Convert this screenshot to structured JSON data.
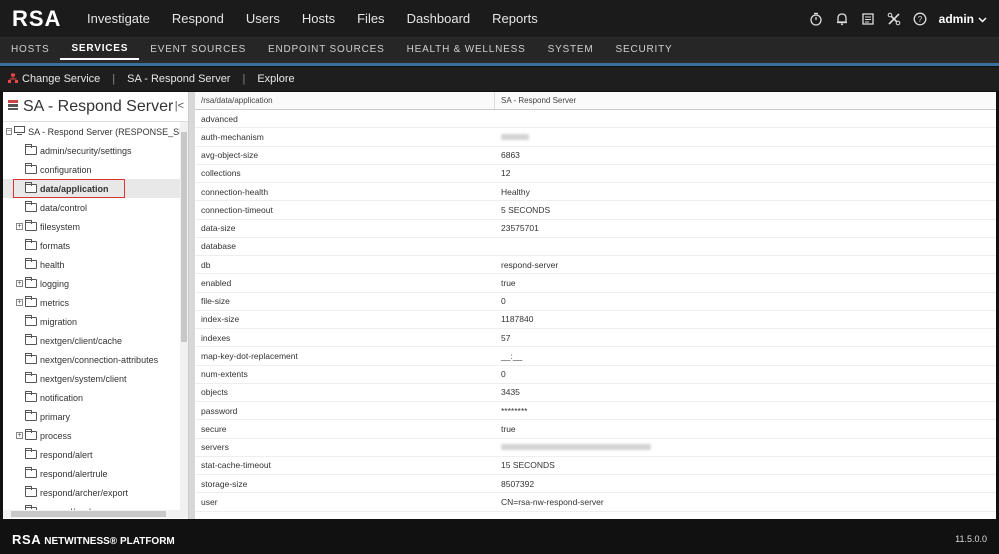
{
  "app": {
    "logo": "RSA"
  },
  "mainnav": [
    "Investigate",
    "Respond",
    "Users",
    "Hosts",
    "Files",
    "Dashboard",
    "Reports"
  ],
  "user": {
    "name": "admin"
  },
  "subnav": [
    "HOSTS",
    "SERVICES",
    "EVENT SOURCES",
    "ENDPOINT SOURCES",
    "HEALTH & WELLNESS",
    "SYSTEM",
    "SECURITY"
  ],
  "toolbar": {
    "change_service": "Change Service",
    "server": "SA - Respond Server",
    "explore": "Explore"
  },
  "left": {
    "title": "SA - Respond Server",
    "root": "SA - Respond Server (RESPONSE_SERV...",
    "items": [
      {
        "label": "admin/security/settings",
        "expand": false
      },
      {
        "label": "configuration",
        "expand": false
      },
      {
        "label": "data/application",
        "expand": false
      },
      {
        "label": "data/control",
        "expand": false
      },
      {
        "label": "filesystem",
        "expand": true
      },
      {
        "label": "formats",
        "expand": false
      },
      {
        "label": "health",
        "expand": false
      },
      {
        "label": "logging",
        "expand": true
      },
      {
        "label": "metrics",
        "expand": true
      },
      {
        "label": "migration",
        "expand": false
      },
      {
        "label": "nextgen/client/cache",
        "expand": false
      },
      {
        "label": "nextgen/connection-attributes",
        "expand": false
      },
      {
        "label": "nextgen/system/client",
        "expand": false
      },
      {
        "label": "notification",
        "expand": false
      },
      {
        "label": "primary",
        "expand": false
      },
      {
        "label": "process",
        "expand": true
      },
      {
        "label": "respond/alert",
        "expand": false
      },
      {
        "label": "respond/alertrule",
        "expand": false
      },
      {
        "label": "respond/archer/export",
        "expand": false
      },
      {
        "label": "respond/cache",
        "expand": false
      }
    ]
  },
  "table": {
    "header_path": "/rsa/data/application",
    "header_server": "SA - Respond Server",
    "rows": [
      {
        "k": "advanced",
        "v": ""
      },
      {
        "k": "auth-mechanism",
        "v": "",
        "blur": true
      },
      {
        "k": "avg-object-size",
        "v": "6863"
      },
      {
        "k": "collections",
        "v": "12"
      },
      {
        "k": "connection-health",
        "v": "Healthy"
      },
      {
        "k": "connection-timeout",
        "v": "5 SECONDS"
      },
      {
        "k": "data-size",
        "v": "23575701"
      },
      {
        "k": "database",
        "v": ""
      },
      {
        "k": "db",
        "v": "respond-server"
      },
      {
        "k": "enabled",
        "v": "true"
      },
      {
        "k": "file-size",
        "v": "0"
      },
      {
        "k": "index-size",
        "v": "1187840"
      },
      {
        "k": "indexes",
        "v": "57"
      },
      {
        "k": "map-key-dot-replacement",
        "v": "__:__"
      },
      {
        "k": "num-extents",
        "v": "0"
      },
      {
        "k": "objects",
        "v": "3435"
      },
      {
        "k": "password",
        "v": "********"
      },
      {
        "k": "secure",
        "v": "true"
      },
      {
        "k": "servers",
        "v": "",
        "blur": true
      },
      {
        "k": "stat-cache-timeout",
        "v": "15 SECONDS"
      },
      {
        "k": "storage-size",
        "v": "8507392"
      },
      {
        "k": "user",
        "v": "CN=rsa-nw-respond-server"
      }
    ]
  },
  "footer": {
    "rsa": "RSA",
    "platform": "NETWITNESS® PLATFORM",
    "version": "11.5.0.0"
  }
}
